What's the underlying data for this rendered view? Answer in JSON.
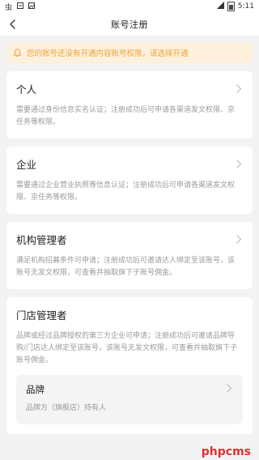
{
  "status_bar": {
    "time": "5:11",
    "left_icons": [
      "carrier-icon",
      "pinyin-icon",
      "image-icon"
    ],
    "right_icons": [
      "signal-icon",
      "battery-icon"
    ]
  },
  "header": {
    "title": "账号注册"
  },
  "notice": {
    "text": "您的账号还没有开通内容账号权限，请选择开通",
    "color": "#f0a23a",
    "background": "#fdf0dc"
  },
  "cards": [
    {
      "title": "个人",
      "description": "需要通过身份信息实名认证；注册成功后可申请各渠道发文权限、京任务等权限。"
    },
    {
      "title": "企业",
      "description": "需要通过企业营业执照等信息认证；注册成功后可申请各渠道发文权限、京任务等权限。"
    },
    {
      "title": "机构管理者",
      "description": "满足机构招募条件可申请；注册成功后可邀请达人绑定至该账号，该账号无发文权限，可查看并抽取旗下子账号佣金。"
    },
    {
      "title": "门店管理者",
      "description": "品牌或经过品牌授权的第三方企业可申请；注册成功后可邀请品牌导购/门店达人绑定至该账号，该账号无发文权限，可查看并抽取旗下子账号佣金。",
      "sub_option": {
        "title": "品牌",
        "description": "品牌方（旗舰店）持有人"
      }
    }
  ],
  "watermark": "phpcms"
}
